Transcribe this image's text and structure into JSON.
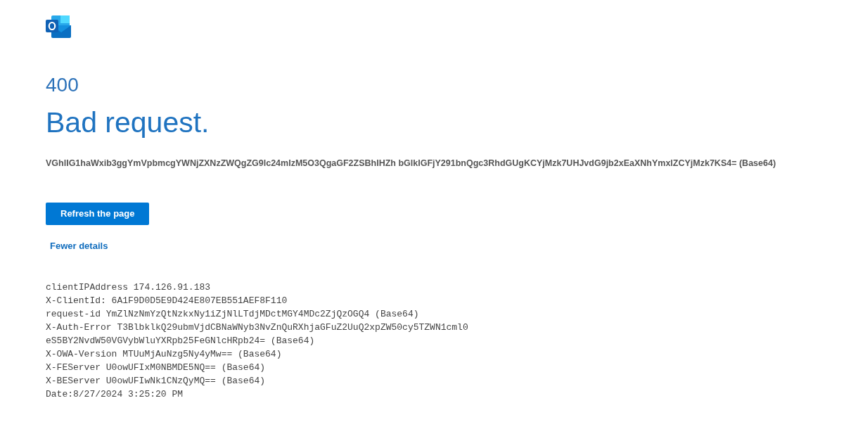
{
  "error_code": "400",
  "title": "Bad request.",
  "message": "VGhlIG1haWxib3ggYmVpbmcgYWNjZXNzZWQgZG9lc24mIzM5O3QgaGF2ZSBhIHZh bGlkIGFjY291bnQgc3RhdGUgKCYjMzk7UHJvdG9jb2xEaXNhYmxlZCYjMzk7KS4= (Base64)",
  "refresh_button": "Refresh the page",
  "details_link": "Fewer details",
  "details": [
    "clientIPAddress 174.126.91.183",
    "X-ClientId: 6A1F9D0D5E9D424E807EB551AEF8F110",
    "request-id YmZlNzNmYzQtNzkxNy1iZjNlLTdjMDctMGY4MDc2ZjQzOGQ4 (Base64)",
    "X-Auth-Error T3BlbklkQ29ubmVjdCBNaWNyb3NvZnQuRXhjaGFuZ2UuQ2xpZW50cy5TZWN1cml0",
    "eS5BY2NvdW50VGVybWluYXRpb25FeGNlcHRpb24= (Base64)",
    "X-OWA-Version MTUuMjAuNzg5Ny4yMw== (Base64)",
    "X-FEServer U0owUFIxM0NBMDE5NQ== (Base64)",
    "X-BEServer U0owUFIwNk1CNzQyMQ== (Base64)",
    "Date:8/27/2024 3:25:20 PM"
  ]
}
